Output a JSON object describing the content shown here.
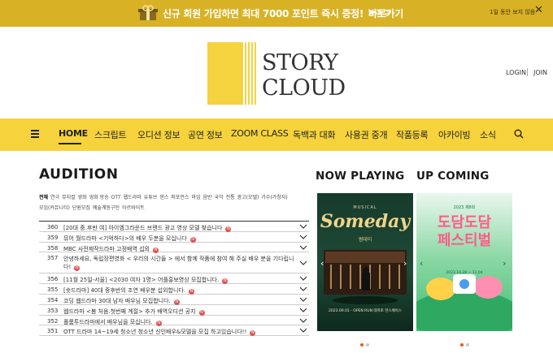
{
  "promo": {
    "text_prefix": "신규 회원 가입하면 최대 7000 포인트 즉시 증정!",
    "link": "바로가기",
    "arrows": ">>>",
    "hide_today": "1일 동안 보지 않음",
    "close": "✕"
  },
  "logo": {
    "line1": "STORY",
    "line2": "CLOUD"
  },
  "auth": {
    "login": "LOGIN",
    "join": "JOIN"
  },
  "nav": {
    "items": [
      "HOME",
      "스크립트",
      "오디션 정보",
      "공연 정보",
      "ZOOM CLASS",
      "독백과 대화",
      "사용권 중개",
      "작품등록",
      "아카이빙",
      "소식"
    ],
    "active": "HOME"
  },
  "audition": {
    "title": "AUDITION",
    "categories": [
      "전체",
      "연극",
      "뮤지컬",
      "영화",
      "영화 방송",
      "OTT",
      "웹드라마",
      "유튜브",
      "댄스",
      "퍼포먼스",
      "마임",
      "음반",
      "국악",
      "전통",
      "광고(모델)",
      "가수(가창자)",
      "모임(커뮤니티)",
      "단원모집",
      "예술계동구인",
      "아르바이트"
    ],
    "selected_category": "전체",
    "rows": [
      {
        "num": "360",
        "title": "[20대 중.후반 여] 아이엠그라운드 브랜드 광고 영상 모델 찾습니다",
        "new": "N"
      },
      {
        "num": "359",
        "title": "뮤어 월드라마 <기억하다>의 배우 두분을 모십니다",
        "new": "N"
      },
      {
        "num": "358",
        "title": "MBC 사전제작드라마 고정배역 섭외",
        "new": "N"
      },
      {
        "num": "357",
        "title": "안녕하세요, 독립장편영화 < 우리의 시간들 > 에서 함께 작품에 참여 해 주실 배우 분을 기다립니다!",
        "new": "N"
      },
      {
        "num": "356",
        "title": "[11월 25일-서울] <2030 여자 1명> 어플홍보영상 모집합니다.",
        "new": "N"
      },
      {
        "num": "355",
        "title": "[숏드라마] 40대 중후반의 조연 배우분 섭외합니다.",
        "new": "N"
      },
      {
        "num": "354",
        "title": "코딩 웹드라마 30대 남자 배우님 모집합니다.",
        "new": "N"
      },
      {
        "num": "353",
        "title": "웹드라마 <봄 처음.첫번째 계절> 추가 배역오디션 공지",
        "new": "N"
      },
      {
        "num": "352",
        "title": "폴룸투드라마에서 배우님을 모십니다.",
        "new": "N"
      },
      {
        "num": "351",
        "title": "OTT 드라마 14~19세 청소년 청소년 신인배우&모델을 모집 하고있습니다!!",
        "new": "N"
      }
    ]
  },
  "now_playing": {
    "title": "NOW PLAYING",
    "poster": {
      "tagline": "MUSICAL",
      "name": "Someday",
      "sub": "썸데이",
      "footer": "2023.09.01 - OPEN RUN  대학로 한스페이스"
    }
  },
  "up_coming": {
    "title": "UP COMING",
    "poster": {
      "tagline": "2023 제8회",
      "name_line1": "도담도담",
      "name_line2": "페스티벌",
      "date": "2023.10.28 ~ 11.04"
    }
  },
  "colors": {
    "accent": "#f6d33c",
    "promo": "#d9b125",
    "new_badge": "#e05050",
    "dot_active": "#e55a1c"
  }
}
